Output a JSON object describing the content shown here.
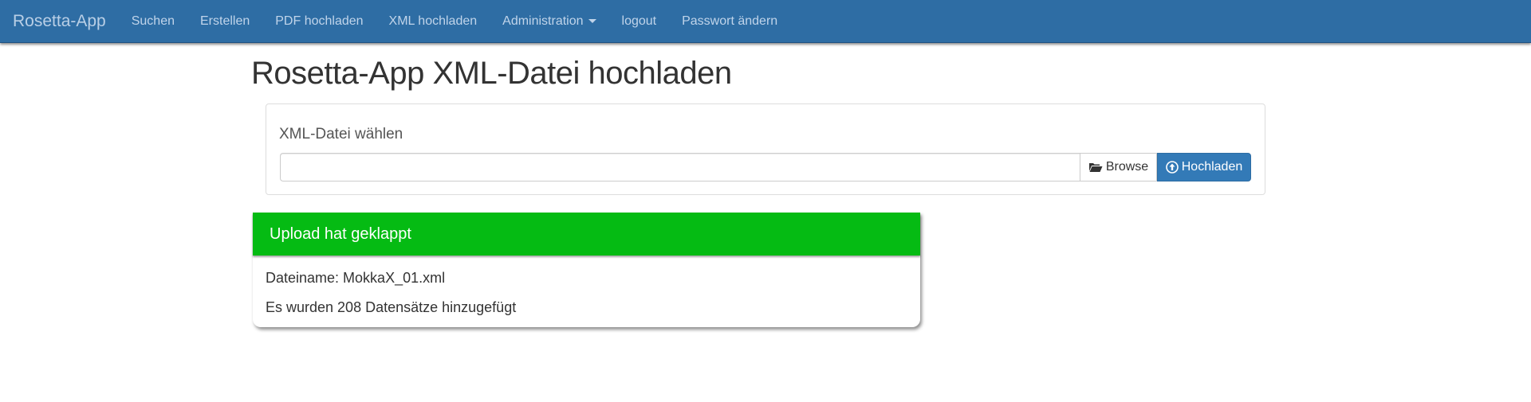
{
  "navbar": {
    "brand": "Rosetta-App",
    "items": [
      {
        "label": "Suchen"
      },
      {
        "label": "Erstellen"
      },
      {
        "label": "PDF hochladen"
      },
      {
        "label": "XML hochladen"
      },
      {
        "label": "Administration",
        "dropdown": true
      },
      {
        "label": "logout"
      },
      {
        "label": "Passwort ändern"
      }
    ]
  },
  "page": {
    "title": "Rosetta-App XML-Datei hochladen"
  },
  "upload_form": {
    "label": "XML-Datei wählen",
    "file_value": "",
    "browse_label": "Browse",
    "upload_label": "Hochladen",
    "browse_icon": "folder-open-icon",
    "upload_icon": "circle-arrow-up-icon"
  },
  "result": {
    "header": "Upload hat geklappt",
    "filename_line": "Dateiname: MokkaX_01.xml",
    "records_line": "Es wurden 208 Datensätze hinzugefügt",
    "header_color": "#05bb13"
  },
  "colors": {
    "navbar": "#2e6da4",
    "primary_button": "#337ab7",
    "success": "#05bb13"
  }
}
